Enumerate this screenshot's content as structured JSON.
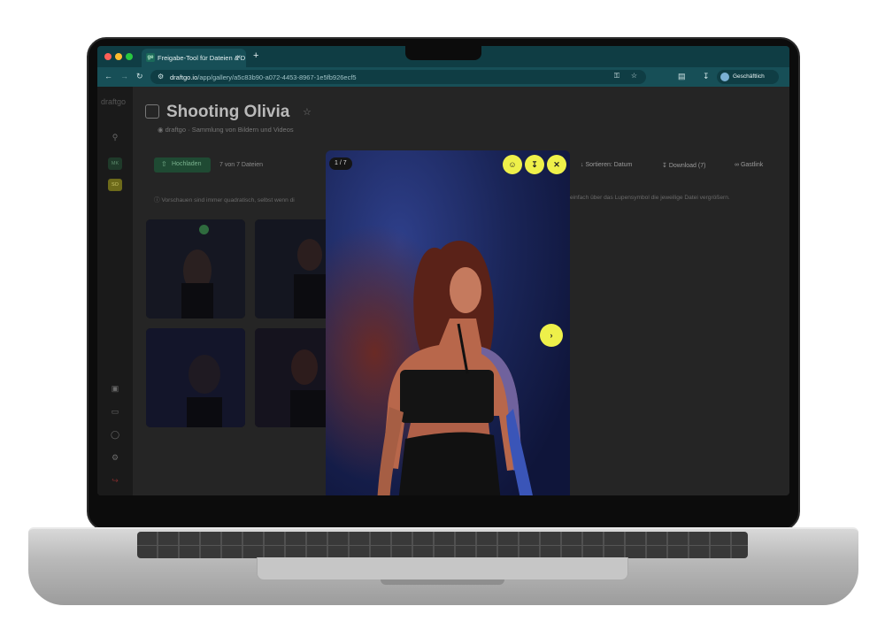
{
  "browser": {
    "tab_title": "Freigabe-Tool für Dateien & D",
    "tab_favicon": "ge",
    "url_host": "draftgo.io",
    "url_path": "/app/gallery/a5c83b90-a072-4453-8967-1e5fb926ecf5",
    "profile_label": "Geschäftlich",
    "new_tab": "+",
    "close": "×"
  },
  "sidebar": {
    "logo": "draftgo",
    "badge_1": "MK",
    "badge_2": "SO"
  },
  "header": {
    "title": "Shooting Olivia",
    "breadcrumb_owner": "draftgo",
    "breadcrumb_collection": "Sammlung von Bildern und Videos"
  },
  "toolbar": {
    "upload_label": "Hochladen",
    "file_count": "7 von 7 Dateien",
    "sort_label": "Sortieren: Datum",
    "download_label": "Download (7)",
    "guest_link_label": "Gastlink"
  },
  "info_text_left": "Vorschauen sind immer quadratisch, selbst wenn di",
  "info_text_right": "einfach über das Lupensymbol die jeweilige Datei vergrößern.",
  "lightbox": {
    "counter": "1 / 7"
  },
  "colors": {
    "accent_yellow": "#eef04a",
    "chrome_teal": "#174f57",
    "chat_red": "#7a1414"
  },
  "icons": [
    "search-icon",
    "archive-icon",
    "trash-icon",
    "shield-icon",
    "gear-icon",
    "logout-icon",
    "star-icon",
    "approve-icon",
    "download-icon",
    "close-icon",
    "chevron-right-icon",
    "link-icon",
    "chat-icon"
  ]
}
